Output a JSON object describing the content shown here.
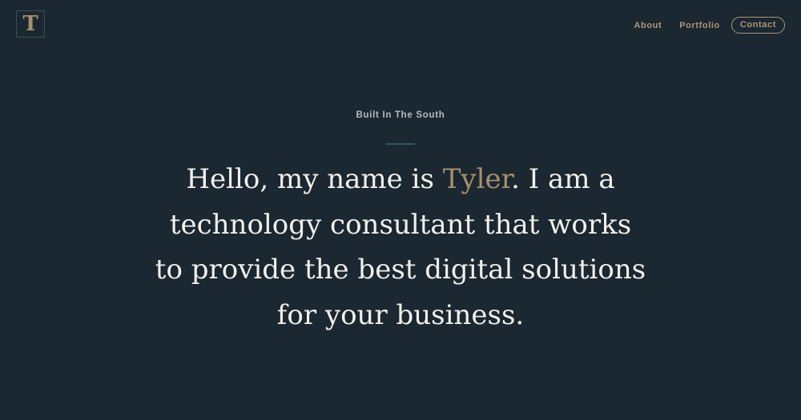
{
  "logo": {
    "letter": "T"
  },
  "nav": {
    "about": "About",
    "portfolio": "Portfolio",
    "contact": "Contact"
  },
  "hero": {
    "eyebrow": "Built In The South",
    "intro": "Hello, my name is ",
    "name": "Tyler",
    "outro": ". I am a technology consultant that works to provide the best digital solutions for your business."
  },
  "colors": {
    "background": "#1b2731",
    "accent": "#a7916b",
    "nav_text": "#ad9775",
    "headline_text": "#f2f0ec",
    "divider": "#2b5d63"
  }
}
